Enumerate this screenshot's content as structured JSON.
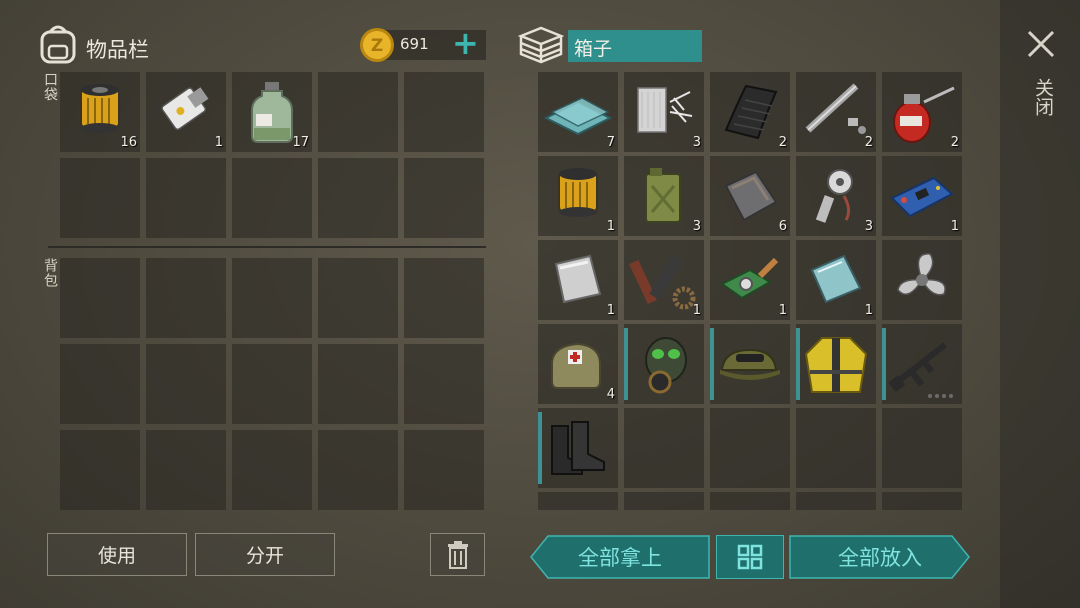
{
  "inventory": {
    "title": "物品栏",
    "icon": "backpack-icon",
    "pocket_label": "口袋",
    "backpack_label": "背包",
    "pocket_items": [
      {
        "icon": "oil-filter-icon",
        "qty": "16"
      },
      {
        "icon": "keycard-icon",
        "qty": "1"
      },
      {
        "icon": "medicine-bottle-icon",
        "qty": "17"
      }
    ]
  },
  "currency": {
    "icon": "coin-icon",
    "value": "691",
    "add_label": "+"
  },
  "box": {
    "title": "箱子",
    "icon": "box-stack-icon",
    "items": [
      {
        "icon": "glass-sheets-icon",
        "qty": "7"
      },
      {
        "icon": "fiberglass-icon",
        "qty": "3"
      },
      {
        "icon": "rubber-sheet-icon",
        "qty": "2"
      },
      {
        "icon": "pipe-parts-icon",
        "qty": "2"
      },
      {
        "icon": "oil-can-icon",
        "qty": "2"
      },
      {
        "icon": "oil-filter-icon",
        "qty": "1"
      },
      {
        "icon": "jerry-can-icon",
        "qty": "3"
      },
      {
        "icon": "metal-plate-icon",
        "qty": "6"
      },
      {
        "icon": "engine-parts-icon",
        "qty": "3"
      },
      {
        "icon": "circuit-board-icon",
        "qty": "1"
      },
      {
        "icon": "steel-sheet-icon",
        "qty": "1"
      },
      {
        "icon": "tools-gears-icon",
        "qty": "1"
      },
      {
        "icon": "camera-module-icon",
        "qty": "1"
      },
      {
        "icon": "glass-panel-icon",
        "qty": "1"
      },
      {
        "icon": "propeller-icon",
        "qty": ""
      },
      {
        "icon": "medkit-bag-icon",
        "qty": "4"
      },
      {
        "icon": "gas-mask-icon",
        "qty": ""
      },
      {
        "icon": "camo-cap-icon",
        "qty": ""
      },
      {
        "icon": "hazmat-jacket-icon",
        "qty": ""
      },
      {
        "icon": "rifle-icon",
        "qty": ""
      },
      {
        "icon": "combat-boots-icon",
        "qty": ""
      }
    ]
  },
  "close_label": "关闭",
  "buttons": {
    "use": "使用",
    "split": "分开",
    "take_all": "全部拿上",
    "put_all": "全部放入"
  },
  "colors": {
    "teal": "#2f8f8c",
    "teal_text": "#7fe3df",
    "gold": "#e8b52a"
  }
}
